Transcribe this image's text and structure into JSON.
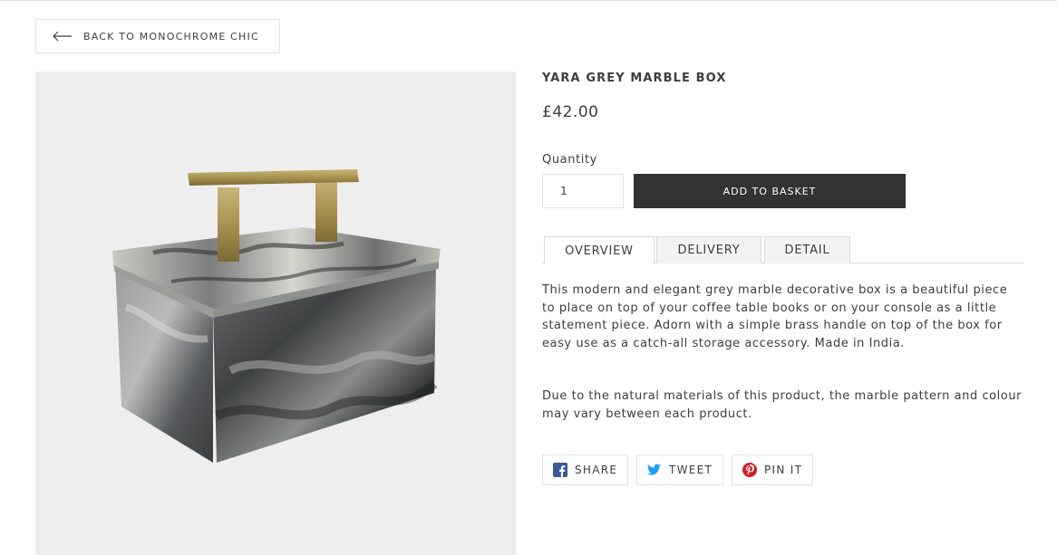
{
  "nav": {
    "back_label": "BACK TO MONOCHROME CHIC"
  },
  "product": {
    "title": "YARA GREY MARBLE BOX",
    "price": "£42.00",
    "quantity_label": "Quantity",
    "quantity_value": "1",
    "add_to_basket_label": "ADD TO BASKET",
    "image_alt": "Yara grey marble box with brass handle"
  },
  "tabs": [
    {
      "label": "OVERVIEW",
      "active": true
    },
    {
      "label": "DELIVERY",
      "active": false
    },
    {
      "label": "DETAIL",
      "active": false
    }
  ],
  "description": {
    "paragraph_1": "This modern and elegant grey marble decorative box is a beautiful piece to place on top of your coffee table books or on your console as a little statement piece. Adorn with a simple brass handle on top of the box for easy use as a catch-all storage accessory. Made in India.",
    "paragraph_2": "Due to the natural materials of this product, the marble pattern and colour may vary between each product."
  },
  "social": {
    "facebook": {
      "label": "SHARE",
      "icon": "facebook-icon",
      "color": "#3b5998"
    },
    "twitter": {
      "label": "TWEET",
      "icon": "twitter-icon",
      "color": "#1da1f2"
    },
    "pinterest": {
      "label": "PIN IT",
      "icon": "pinterest-icon",
      "color": "#cb2027"
    }
  },
  "colors": {
    "button_dark": "#333333",
    "text": "#3d3d3d",
    "border": "#e3e3e3",
    "image_bg": "#eeeded"
  }
}
